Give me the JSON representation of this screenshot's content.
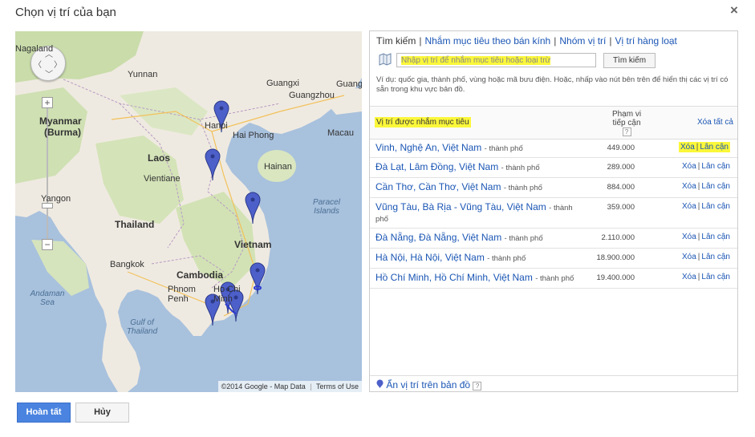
{
  "dialog": {
    "title": "Chọn vị trí của bạn",
    "close": "×"
  },
  "map": {
    "labels": {
      "nagaland": "Nagaland",
      "yunnan": "Yunnan",
      "guangxi": "Guangxi",
      "guangdong": "Guangdong",
      "guangzhou": "Guangzhou",
      "myanmar": "Myanmar",
      "burma": "(Burma)",
      "hanoi": "Hanoi",
      "haiphong": "Hai Phong",
      "macau": "Macau",
      "laos": "Laos",
      "hainan": "Hainan",
      "vientiane": "Vientiane",
      "yangon": "Yangon",
      "paracel": "Paracel Islands",
      "thailand": "Thailand",
      "vietnam": "Vietnam",
      "bangkok": "Bangkok",
      "cambodia": "Cambodia",
      "phnom": "Phnom Penh",
      "hochi": "Ho Chi Minh",
      "andaman": "Andaman Sea",
      "gulf": "Gulf of Thailand"
    },
    "attribution": "©2014 Google - Map Data",
    "terms": "Terms of Use"
  },
  "tabs": {
    "search": "Tìm kiếm",
    "radius": "Nhắm mục tiêu theo bán kính",
    "groups": "Nhóm vị trí",
    "bulk": "Vị trí hàng loạt"
  },
  "search": {
    "placeholder": "Nhập vị trí để nhắm mục tiêu hoặc loại trừ",
    "button": "Tìm kiếm",
    "hint": "Ví dụ: quốc gia, thành phố, vùng hoặc mã bưu điện. Hoặc, nhấp vào nút bên trên để hiển thị các vị trí có sẵn trong khu vực bản đồ."
  },
  "table": {
    "col_location": "Vị trí được nhắm mục tiêu",
    "col_reach_1": "Phạm vi",
    "col_reach_2": "tiếp cận",
    "help": "?",
    "clear_all": "Xóa tất cả",
    "remove": "Xóa",
    "nearby": "Lân cận",
    "sep": "|",
    "rows": [
      {
        "name": "Vinh, Nghệ An, Việt Nam",
        "type": "- thành phố",
        "reach": "449.000"
      },
      {
        "name": "Đà Lạt, Lâm Đồng, Việt Nam",
        "type": "- thành phố",
        "reach": "289.000"
      },
      {
        "name": "Cần Thơ, Cần Thơ, Việt Nam",
        "type": "- thành phố",
        "reach": "884.000"
      },
      {
        "name": "Vũng Tàu, Bà Rịa - Vũng Tàu, Việt Nam",
        "type": "- thành phố",
        "reach": "359.000"
      },
      {
        "name": "Đà Nẵng, Đà Nẵng, Việt Nam",
        "type": "- thành phố",
        "reach": "2.110.000"
      },
      {
        "name": "Hà Nội, Hà Nội, Việt Nam",
        "type": "- thành phố",
        "reach": "18.900.000"
      },
      {
        "name": "Hồ Chí Minh, Hồ Chí Minh, Việt Nam",
        "type": "- thành phố",
        "reach": "19.400.000"
      }
    ]
  },
  "footer": {
    "hide_pins": "Ẩn vị trí trên bản đồ",
    "help": "?"
  },
  "buttons": {
    "done": "Hoàn tất",
    "cancel": "Hủy"
  },
  "colors": {
    "accent": "#4a84e0",
    "link": "#1a55b4",
    "highlight": "#fbf73a",
    "pin": "#4a5fc8"
  }
}
